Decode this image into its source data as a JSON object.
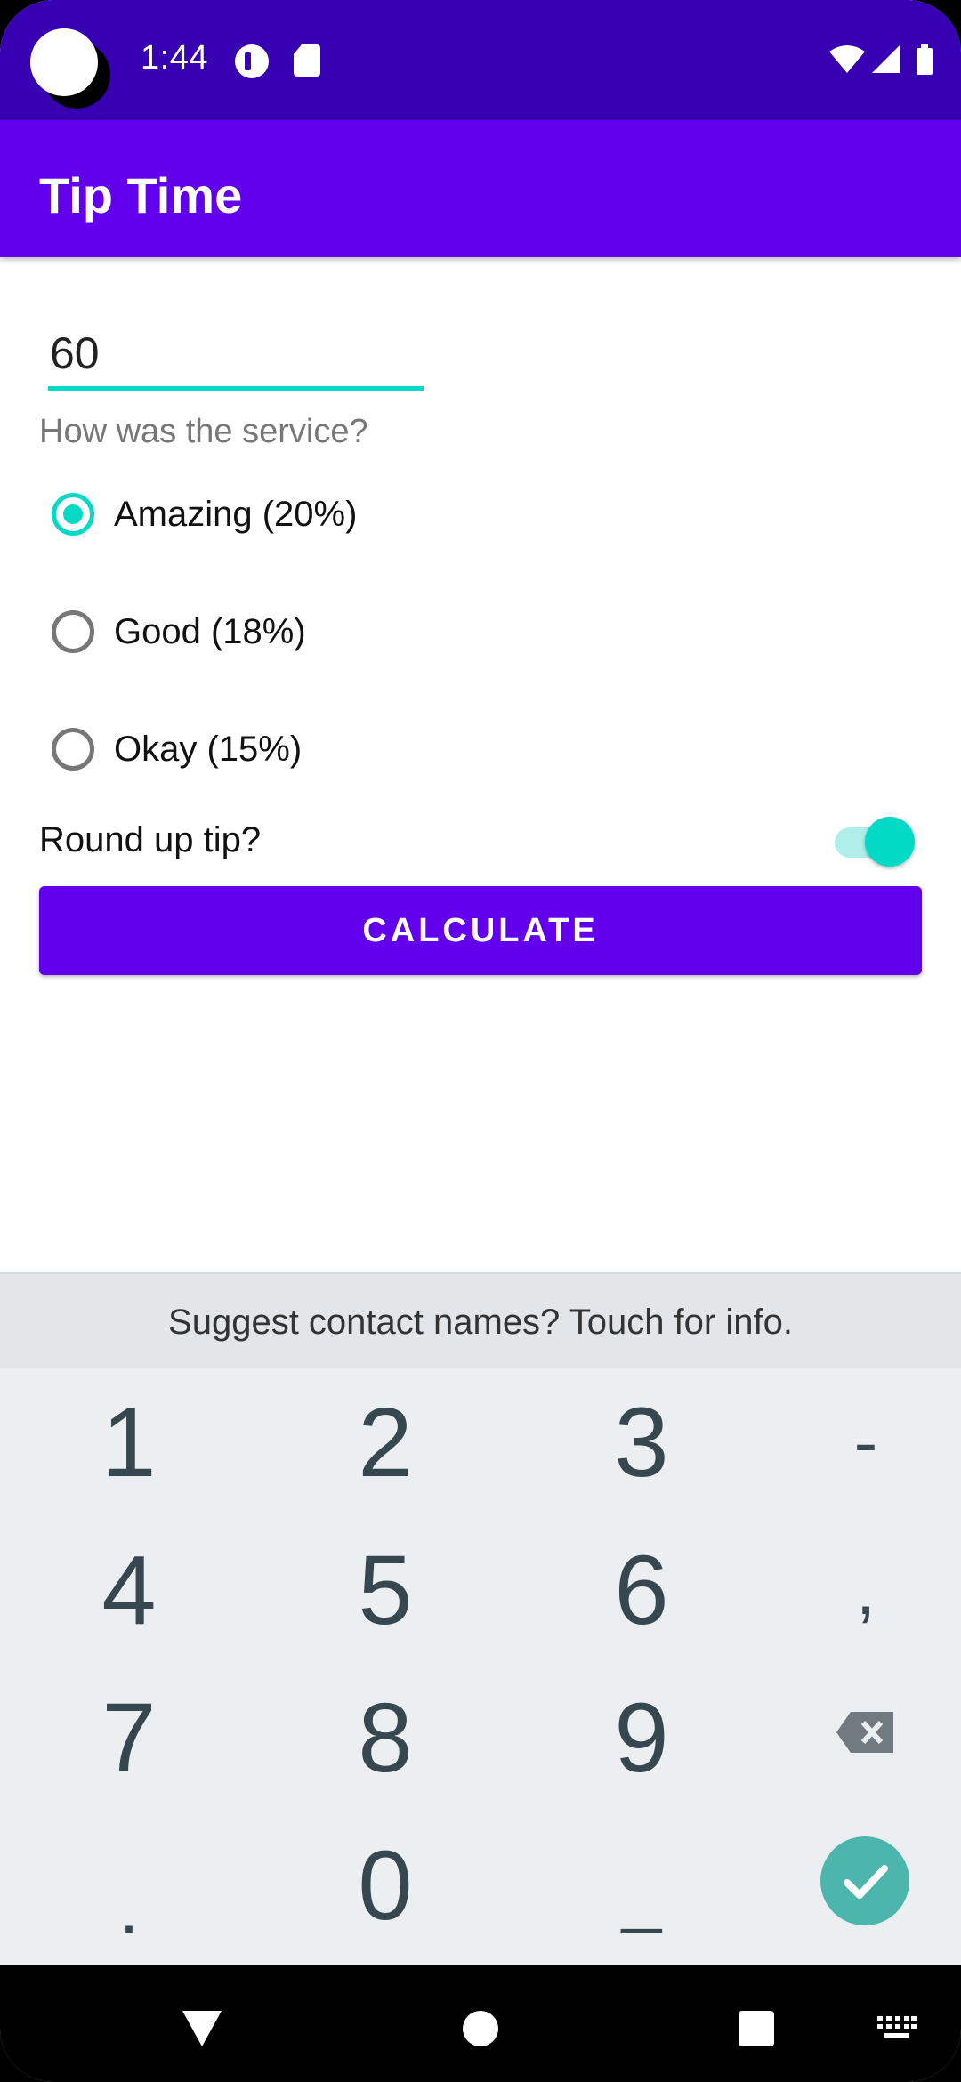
{
  "status_bar": {
    "time": "1:44",
    "icons": [
      "camera-cutout-icon",
      "notification-app-icon",
      "sd-card-icon",
      "wifi-icon",
      "signal-icon",
      "battery-icon"
    ]
  },
  "app_bar": {
    "title": "Tip Time"
  },
  "form": {
    "cost_value": "60",
    "service_question": "How was the service?",
    "options": [
      {
        "label": "Amazing (20%)",
        "selected": true
      },
      {
        "label": "Good (18%)",
        "selected": false
      },
      {
        "label": "Okay (15%)",
        "selected": false
      }
    ],
    "round_up_label": "Round up tip?",
    "round_up_on": true,
    "calculate_label": "CALCULATE"
  },
  "keyboard": {
    "suggestion": "Suggest contact names? Touch for info.",
    "keys": [
      "1",
      "2",
      "3",
      "-",
      "4",
      "5",
      "6",
      ",",
      "7",
      "8",
      "9",
      ".",
      "0",
      "_"
    ]
  },
  "colors": {
    "status_bar": "#3700b3",
    "primary": "#6200ee",
    "accent": "#03dac5",
    "enter_key": "#4db6ac"
  }
}
